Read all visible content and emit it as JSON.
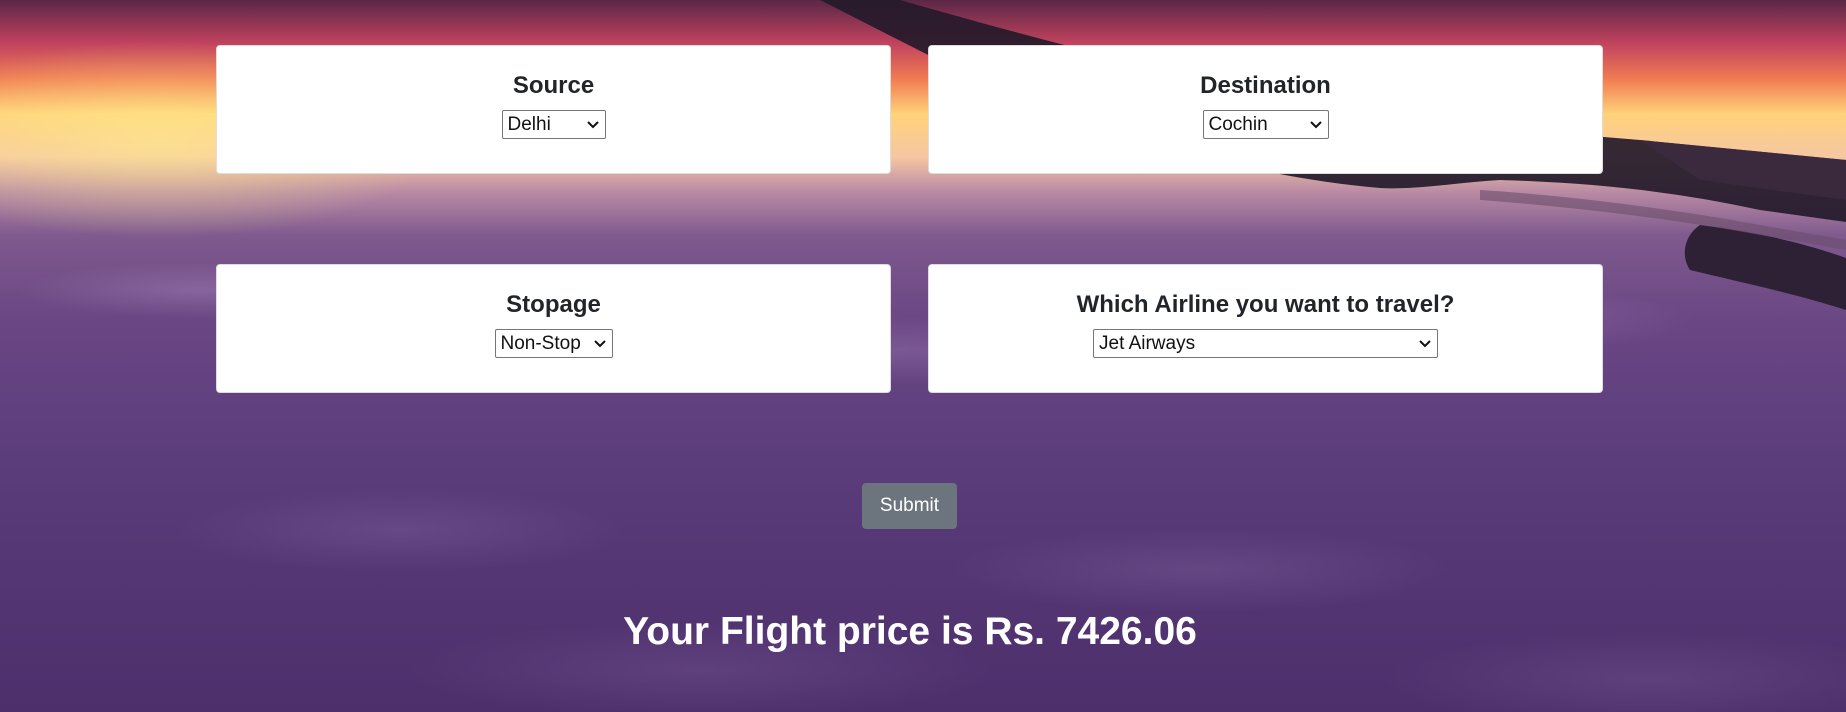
{
  "source": {
    "label": "Source",
    "selected": "Delhi"
  },
  "destination": {
    "label": "Destination",
    "selected": "Cochin"
  },
  "stopage": {
    "label": "Stopage",
    "selected": "Non-Stop"
  },
  "airline": {
    "label": "Which Airline you want to travel?",
    "selected": "Jet Airways"
  },
  "form": {
    "submit_label": "Submit"
  },
  "result": {
    "text": "Your Flight price is Rs. 7426.06"
  },
  "colors": {
    "button_bg": "#6c757d",
    "card_bg": "#ffffff",
    "result_text": "#ffffff"
  },
  "icons": {
    "dropdown": "chevron-down-icon"
  }
}
